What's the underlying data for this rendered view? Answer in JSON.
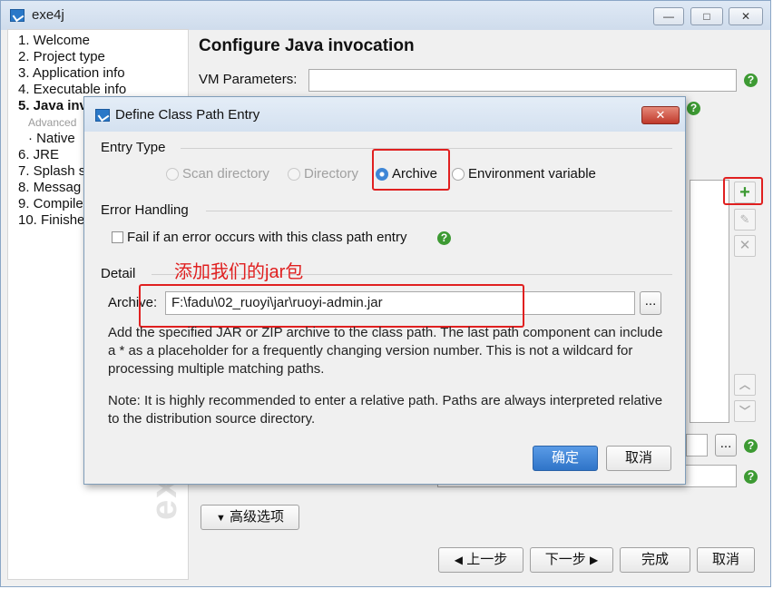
{
  "main_window": {
    "title": "exe4j",
    "controls": {
      "minimize": "—",
      "maximize": "□",
      "close": "✕"
    }
  },
  "sidebar": {
    "items": [
      {
        "label": "1. Welcome"
      },
      {
        "label": "2. Project type"
      },
      {
        "label": "3. Application info"
      },
      {
        "label": "4. Executable info"
      },
      {
        "label": "5. Java inv"
      },
      {
        "label": "Advanced"
      },
      {
        "label": "· Native"
      },
      {
        "label": "6. JRE"
      },
      {
        "label": "7. Splash s"
      },
      {
        "label": "8. Messag"
      },
      {
        "label": "9. Compile"
      },
      {
        "label": "10. Finishe"
      }
    ],
    "watermark": "exe4j"
  },
  "main": {
    "title": "Configure Java invocation",
    "vm_parameters_label": "VM Parameters:",
    "vm_parameters_value": "",
    "advanced_options_label": "高级选项"
  },
  "footer": {
    "back_label": "上一步",
    "next_label": "下一步",
    "finish_label": "完成",
    "cancel_label": "取消"
  },
  "dialog": {
    "title": "Define Class Path Entry",
    "close_label": "✕",
    "entry_type": {
      "label": "Entry Type",
      "options": [
        {
          "label": "Scan directory"
        },
        {
          "label": "Directory"
        },
        {
          "label": "Archive"
        },
        {
          "label": "Environment variable"
        }
      ],
      "selected": "Archive"
    },
    "error_handling": {
      "label": "Error Handling",
      "checkbox_label": "Fail if an error occurs with this class path entry"
    },
    "detail": {
      "label": "Detail",
      "annotation": "添加我们的jar包",
      "archive_label": "Archive:",
      "archive_value": "F:\\fadu\\02_ruoyi\\jar\\ruoyi-admin.jar",
      "browse_label": "...",
      "description_1": "Add the specified JAR or ZIP archive to the class path. The last path component can include a * as a placeholder for a frequently changing version number. This is not a wildcard for processing multiple matching paths.",
      "description_2": "Note: It is highly recommended to enter a relative path. Paths are always interpreted relative to the distribution source directory."
    },
    "ok_label": "确定",
    "cancel_label": "取消"
  },
  "icons": {
    "help": "?",
    "add": "+",
    "remove": "✕",
    "up": "︿",
    "down": "﹀",
    "dropdown": "▼",
    "back_arrow": "◀",
    "next_arrow": "▶",
    "browse": "..."
  },
  "colors": {
    "help_green": "#3d9a33",
    "annotation_red": "#e02020",
    "primary_blue": "#2f74c8"
  }
}
